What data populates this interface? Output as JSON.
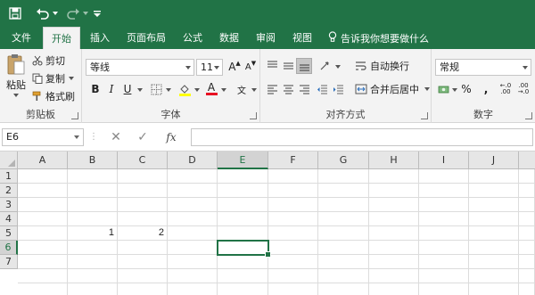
{
  "quick_access": {
    "save_icon": "save-icon",
    "undo_icon": "undo-icon",
    "redo_icon": "redo-icon",
    "customize_icon": "customize-qat-icon"
  },
  "tabs": [
    {
      "label": "文件"
    },
    {
      "label": "开始"
    },
    {
      "label": "插入"
    },
    {
      "label": "页面布局"
    },
    {
      "label": "公式"
    },
    {
      "label": "数据"
    },
    {
      "label": "审阅"
    },
    {
      "label": "视图"
    }
  ],
  "tell_me": "告诉我你想要做什么",
  "clipboard": {
    "paste": "粘贴",
    "cut": "剪切",
    "copy": "复制",
    "format_painter": "格式刷",
    "label": "剪贴板"
  },
  "font": {
    "name": "等线",
    "size": "11",
    "grow": "A",
    "shrink": "A",
    "bold": "B",
    "italic": "I",
    "underline": "U",
    "font_color": "A",
    "phonetic": "文",
    "label": "字体"
  },
  "alignment": {
    "wrap_text": "自动换行",
    "merge_center": "合并后居中",
    "label": "对齐方式"
  },
  "number": {
    "format": "常规",
    "percent": "%",
    "comma": ",",
    "label": "数字"
  },
  "formula_bar": {
    "name_box": "E6",
    "fx": "fx",
    "formula": ""
  },
  "sheet": {
    "columns": [
      "A",
      "B",
      "C",
      "D",
      "E",
      "F",
      "G",
      "H",
      "I",
      "J"
    ],
    "rows": [
      "1",
      "2",
      "3",
      "4",
      "5",
      "6",
      "7"
    ],
    "active_cell": "E6",
    "cells": {
      "B5": "1",
      "C5": "2"
    }
  },
  "colors": {
    "brand": "#217346",
    "ribbon_bg": "#f3f3f3",
    "font_color_bar": "#e81123",
    "highlight_bar": "#ffff00"
  }
}
